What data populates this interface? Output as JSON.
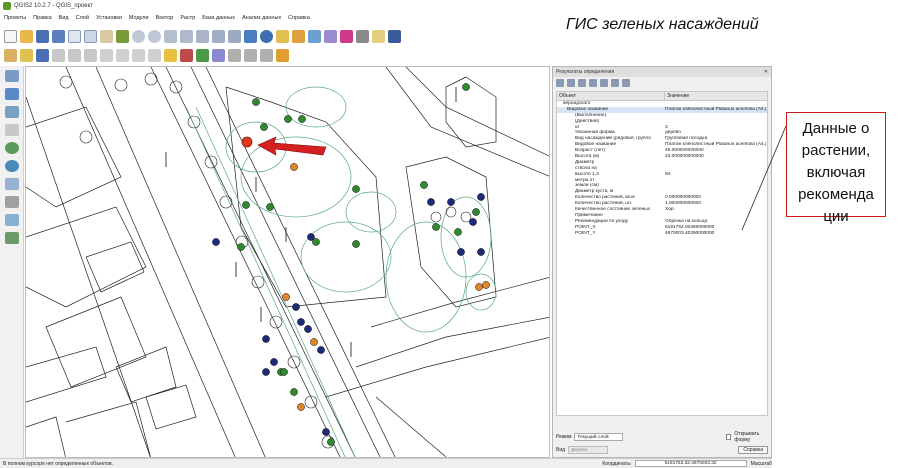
{
  "window": {
    "title": "QGIS2 10.2.7 - QGIS_проект"
  },
  "menu": [
    "Проекты",
    "Правка",
    "Вид",
    "Слой",
    "Установки",
    "Модули",
    "Вектор",
    "Растр",
    "База данных",
    "Анализ данных",
    "Справка"
  ],
  "annotation": {
    "heading": "ГИС зеленых насаждений",
    "callout_text": "Данные о растении, включая рекоменда ции"
  },
  "identify_panel": {
    "title": "Результаты определения",
    "columns": [
      "Объект",
      "Значение"
    ],
    "rows": [
      [
        "вернадского",
        ""
      ],
      [
        "Видовое название",
        "Платан клёнолистный Platanus acerifolia (Ait.)"
      ],
      [
        "(Выполнение)",
        ""
      ],
      [
        "(Действия)",
        ""
      ],
      [
        "id",
        "3"
      ],
      [
        "Указанная форма",
        "дерево"
      ],
      [
        "Вид насаждений (рядовая, группо",
        "Групповая посадка"
      ],
      [
        "Видовое название",
        "Платан клёнолистный Platanus acerifolia (Ait.)"
      ],
      [
        "Возраст (лет)",
        "45.000000000000"
      ],
      [
        "Высота (м)",
        "23.000000000000"
      ],
      [
        "Диаметр",
        ""
      ],
      [
        "ствола на",
        ""
      ],
      [
        "высоте 1,3",
        "94"
      ],
      [
        "метра от",
        ""
      ],
      [
        "земли (см)",
        ""
      ],
      [
        "Диаметр куста, м",
        ""
      ],
      [
        "Количество растений, кв.м",
        "0.000000000000"
      ],
      [
        "Количество растений, шт.",
        "1.000000000000"
      ],
      [
        "Качественное состояние зеленых",
        "Хор."
      ],
      [
        "Примечание",
        ""
      ],
      [
        "Рекомендации по уходу",
        "Обрезка на кольца"
      ],
      [
        "POINT_X",
        "5191752.00360000000"
      ],
      [
        "POINT_Y",
        "4970003.40390000000"
      ]
    ],
    "mode_label": "Режим",
    "mode_value": "Текущий слой",
    "open_form_label": "Открывать форму",
    "view_label": "Вид",
    "view_value": "Дерево",
    "help_button": "Справка"
  },
  "statusbar": {
    "message": "В полном курсоре нет определенных объектов.",
    "coord_label": "Координаты",
    "coord_value": "5191752.32,4970003.32",
    "scale_label": "Масштаб"
  },
  "colors": {
    "tree_green": "#2f8a2f",
    "tree_blue": "#1c2a78",
    "tree_orange": "#e0852a",
    "tree_red": "#e03a1a",
    "contour": "#5aa88a",
    "arrow": "#d42020"
  }
}
